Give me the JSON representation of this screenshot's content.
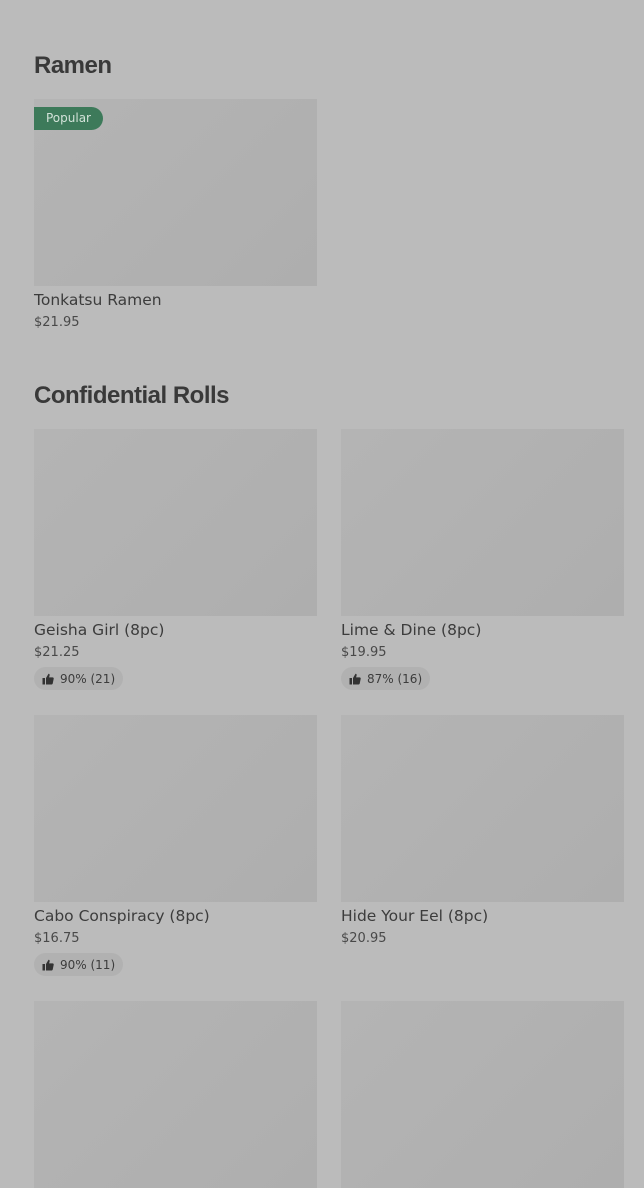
{
  "sections": [
    {
      "title": "Ramen",
      "items": [
        {
          "name": "Tonkatsu Ramen",
          "price": "$21.95",
          "badge": "Popular"
        }
      ]
    },
    {
      "title": "Confidential Rolls",
      "items": [
        {
          "name": "Geisha Girl (8pc)",
          "price": "$21.25",
          "rating": "90% (21)"
        },
        {
          "name": "Lime & Dine (8pc)",
          "price": "$19.95",
          "rating": "87% (16)"
        },
        {
          "name": "Cabo Conspiracy (8pc)",
          "price": "$16.75",
          "rating": "90% (11)"
        },
        {
          "name": "Hide Your Eel (8pc)",
          "price": "$20.95"
        }
      ]
    }
  ],
  "icons": {
    "rating": "thumbs-up-icon"
  },
  "colors": {
    "background": "#bbbbbb",
    "badge": "#3d7a5a",
    "thumbnail": "#b1b1b1"
  }
}
